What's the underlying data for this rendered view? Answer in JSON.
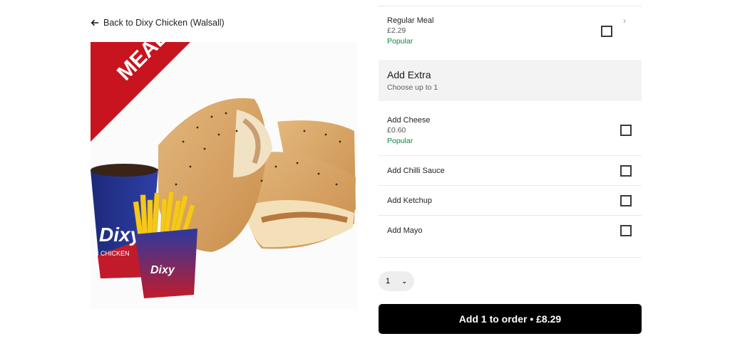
{
  "nav": {
    "back_label": "Back to Dixy Chicken (Walsall)"
  },
  "image": {
    "badge_text": "MEAL",
    "brand_text": "Dixy",
    "brand_sub": "CHICKEN"
  },
  "options_top": [
    {
      "name": "Regular Meal",
      "price": "£2.29",
      "popular": "Popular"
    }
  ],
  "add_extra": {
    "title": "Add Extra",
    "subtitle": "Choose up to 1",
    "items": [
      {
        "name": "Add Cheese",
        "price": "£0.60",
        "popular": "Popular"
      },
      {
        "name": "Add Chilli Sauce"
      },
      {
        "name": "Add Ketchup"
      },
      {
        "name": "Add Mayo"
      }
    ]
  },
  "quantity": {
    "value": "1"
  },
  "order": {
    "button_label": "Add 1 to order • £8.29"
  },
  "colors": {
    "popular": "#0e8345",
    "button_bg": "#000000",
    "section_bg": "#f3f3f3",
    "meal_badge": "#c8141e"
  },
  "icons": {
    "back": "arrow-left-icon",
    "chevron": "chevron-right-icon",
    "qty": "chevron-down-icon"
  }
}
